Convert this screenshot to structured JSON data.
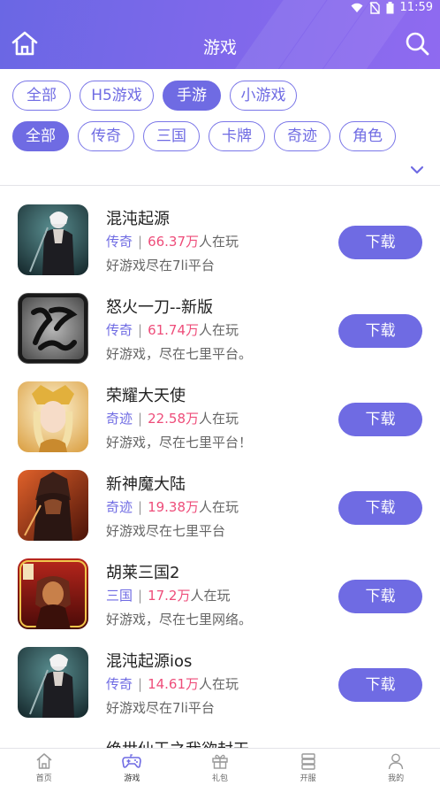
{
  "status_bar": {
    "time": "11:59",
    "colors": {
      "icons": "#ffffff"
    }
  },
  "header": {
    "title": "游戏",
    "home_icon": "home-icon",
    "search_icon": "search-icon",
    "gradient": [
      "#6a67e4",
      "#8f6af0"
    ]
  },
  "filters": {
    "platform_tabs": [
      "全部",
      "H5游戏",
      "手游",
      "小游戏"
    ],
    "platform_selected": "手游",
    "categories": [
      "全部",
      "传奇",
      "三国",
      "卡牌",
      "奇迹",
      "角色"
    ],
    "category_selected": "全部",
    "expand_icon": "chevron-down-icon",
    "accent": "#6f6be3"
  },
  "games": [
    {
      "name": "混沌起源",
      "category": "传奇",
      "players": "66.37万",
      "players_suffix": "人在玩",
      "desc": "好游戏尽在7li平台",
      "button": "下载"
    },
    {
      "name": "怒火一刀--新版",
      "category": "传奇",
      "players": "61.74万",
      "players_suffix": "人在玩",
      "desc": "好游戏，尽在七里平台。",
      "button": "下载"
    },
    {
      "name": "荣耀大天使",
      "category": "奇迹",
      "players": "22.58万",
      "players_suffix": "人在玩",
      "desc": "好游戏，尽在七里平台！",
      "button": "下载"
    },
    {
      "name": "新神魔大陆",
      "category": "奇迹",
      "players": "19.38万",
      "players_suffix": "人在玩",
      "desc": "好游戏尽在七里平台",
      "button": "下载"
    },
    {
      "name": "胡莱三国2",
      "category": "三国",
      "players": "17.2万",
      "players_suffix": "人在玩",
      "desc": "好游戏，尽在七里网络。",
      "button": "下载"
    },
    {
      "name": "混沌起源ios",
      "category": "传奇",
      "players": "14.61万",
      "players_suffix": "人在玩",
      "desc": "好游戏尽在7li平台",
      "button": "下载"
    },
    {
      "name": "绝世仙王之我欲封天",
      "category": "",
      "players": "",
      "players_suffix": "",
      "desc": "",
      "button": ""
    }
  ],
  "tabbar": {
    "items": [
      {
        "label": "首页",
        "icon": "home-icon"
      },
      {
        "label": "游戏",
        "icon": "gamepad-icon"
      },
      {
        "label": "礼包",
        "icon": "gift-icon"
      },
      {
        "label": "开服",
        "icon": "server-icon"
      },
      {
        "label": "我的",
        "icon": "user-icon"
      }
    ],
    "active": "游戏"
  }
}
